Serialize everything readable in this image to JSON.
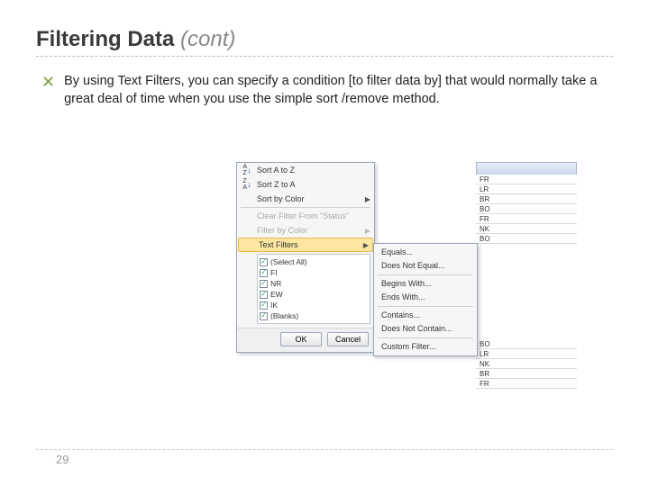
{
  "title": {
    "main": "Filtering Data",
    "suffix": "(cont)"
  },
  "bullet_text": "By using Text Filters, you can specify a condition [to filter data by] that would normally take a great deal of time when you use the simple sort /remove method.",
  "page_number": "29",
  "column_cells_top": [
    "FR",
    "LR",
    "BR",
    "BO",
    "FR",
    "NK",
    "BO"
  ],
  "column_cells_bottom": [
    "BO",
    "LR",
    "NK",
    "BR",
    "FR"
  ],
  "dropdown": {
    "sort_az": "Sort A to Z",
    "sort_za": "Sort Z to A",
    "sort_color": "Sort by Color",
    "clear_filter": "Clear Filter From \"Status\"",
    "filter_color": "Filter by Color",
    "text_filters": "Text Filters",
    "checks": [
      "(Select All)",
      "FI",
      "NR",
      "EW",
      "IK",
      "(Blanks)"
    ],
    "ok": "OK",
    "cancel": "Cancel"
  },
  "submenu": {
    "equals": "Equals...",
    "not_equal": "Does Not Equal...",
    "begins": "Begins With...",
    "ends": "Ends With...",
    "contains": "Contains...",
    "not_contain": "Does Not Contain...",
    "custom": "Custom Filter..."
  }
}
